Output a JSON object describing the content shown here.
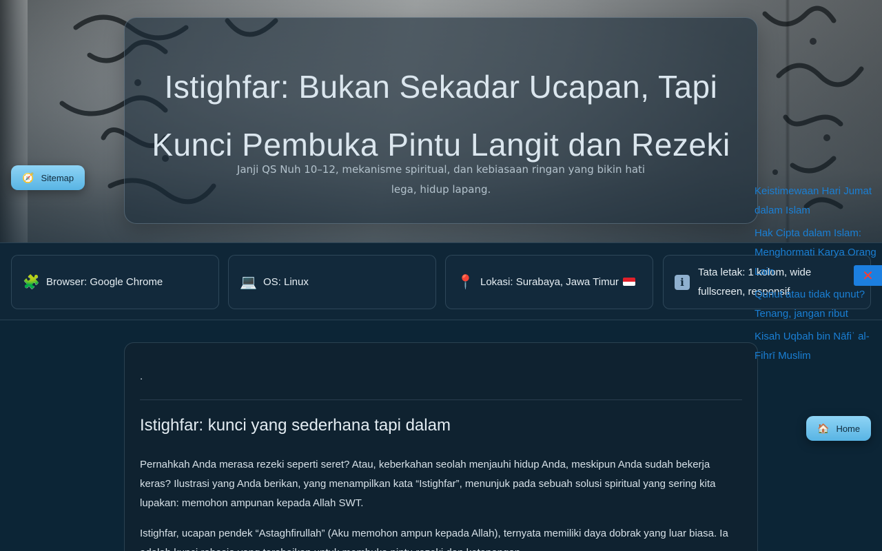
{
  "hero": {
    "title": "Istighfar: Bukan Sekadar Ucapan, Tapi Kunci Pembuka Pintu Langit dan Rezeki",
    "subtitle": "Janji QS Nuh 10–12, mekanisme spiritual, dan kebiasaan ringan yang bikin hati lega, hidup lapang."
  },
  "nav": {
    "sitemap_label": "Sitemap",
    "sitemap_icon": "compass-icon",
    "home_label": "Home",
    "home_icon": "house-icon"
  },
  "info": [
    {
      "icon": "puzzle-icon",
      "text": "Browser: Google Chrome"
    },
    {
      "icon": "laptop-icon",
      "text": "OS: Linux"
    },
    {
      "icon": "pin-icon",
      "text": "Lokasi: Surabaya, Jawa Timur"
    },
    {
      "icon": "info-icon",
      "text": "Tata letak: 1 kolom, wide fullscreen, responsif"
    }
  ],
  "article": {
    "lead_dot": ".",
    "heading": "Istighfar: kunci yang sederhana tapi dalam",
    "p1": "Pernahkah Anda merasa rezeki seperti seret? Atau, keberkahan seolah menjauhi hidup Anda, meskipun Anda sudah bekerja keras? Ilustrasi yang Anda berikan, yang menampilkan kata “Istighfar”, menunjuk pada sebuah solusi spiritual yang sering kita lupakan: memohon ampunan kepada Allah SWT.",
    "p2": "Istighfar, ucapan pendek “Astaghfirullah” (Aku memohon ampun kepada Allah), ternyata memiliki daya dobrak yang luar biasa. Ia adalah kunci rahasia yang terabaikan untuk membuka pintu rezeki dan ketenangan."
  },
  "related": [
    "Keistimewaan Hari Jumat dalam Islam",
    "Hak Cipta dalam Islam: Menghormati Karya Orang Lain",
    "Qunut atau tidak qunut? Tenang, jangan ribut",
    "Kisah Uqbah bin Nāfiʿ al-Fihrī Muslim"
  ],
  "colors": {
    "accent": "#58b4e4",
    "link": "#1a7fd4",
    "close_bg": "#1c7fe0",
    "close_x": "#ff3b30"
  }
}
